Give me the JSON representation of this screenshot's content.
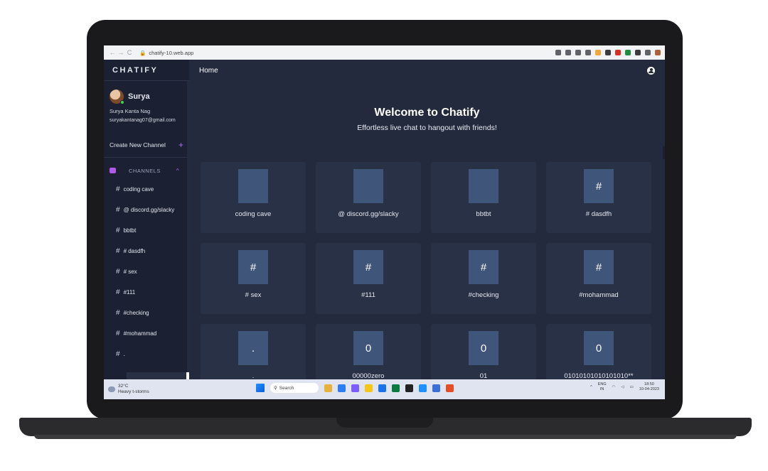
{
  "browser": {
    "url": "chatify-10.web.app",
    "ext_colors": [
      "#5f6368",
      "#5f6368",
      "#5f6368",
      "#5f6368",
      "#f2a73b",
      "#3b3b3b",
      "#d93025",
      "#1e8e3e",
      "#3b3b3b",
      "#5f6368",
      "#b0603a"
    ]
  },
  "sidebar": {
    "brand": "CHATIFY",
    "profile": {
      "name": "Surya",
      "full_name": "Surya Kanta Nag",
      "email": "suryakantanag07@gmail.com"
    },
    "create_channel_label": "Create New Channel",
    "create_channel_plus": "+",
    "channels_header": "CHANNELS",
    "channels": [
      {
        "hash": "#",
        "label": "coding cave"
      },
      {
        "hash": "#",
        "label": "@ discord.gg/slacky"
      },
      {
        "hash": "#",
        "label": "bbtbt"
      },
      {
        "hash": "#",
        "label": "# dasdfh"
      },
      {
        "hash": "#",
        "label": "# sex"
      },
      {
        "hash": "#",
        "label": "#111"
      },
      {
        "hash": "#",
        "label": "#checking"
      },
      {
        "hash": "#",
        "label": "#mohammad"
      },
      {
        "hash": "#",
        "label": "."
      }
    ]
  },
  "main": {
    "page_title": "Home",
    "welcome_title": "Welcome to Chatify",
    "welcome_subtitle": "Effortless live chat to hangout with friends!",
    "cards": [
      {
        "tile": "",
        "label": "coding cave"
      },
      {
        "tile": "",
        "label": "@ discord.gg/slacky"
      },
      {
        "tile": "",
        "label": "bbtbt"
      },
      {
        "tile": "#",
        "label": "# dasdfh"
      },
      {
        "tile": "#",
        "label": "# sex"
      },
      {
        "tile": "#",
        "label": "#111"
      },
      {
        "tile": "#",
        "label": "#checking"
      },
      {
        "tile": "#",
        "label": "#mohammad"
      },
      {
        "tile": ".",
        "label": "."
      },
      {
        "tile": "0",
        "label": "00000zero"
      },
      {
        "tile": "0",
        "label": "01"
      },
      {
        "tile": "0",
        "label": "01010101010101010**"
      }
    ]
  },
  "taskbar": {
    "weather_temp": "32°C",
    "weather_desc": "Heavy t-storms",
    "search_label": "Search",
    "lang_top": "ENG",
    "lang_bottom": "IN",
    "time": "18:50",
    "date": "10-04-2023",
    "app_colors": [
      "#e8b23a",
      "#2d7cf6",
      "#7c5cff",
      "#f5c518",
      "#1a73e8",
      "#0a7a3f",
      "#222222",
      "#1e90ff",
      "#3b6fd8",
      "#e44d26"
    ]
  }
}
